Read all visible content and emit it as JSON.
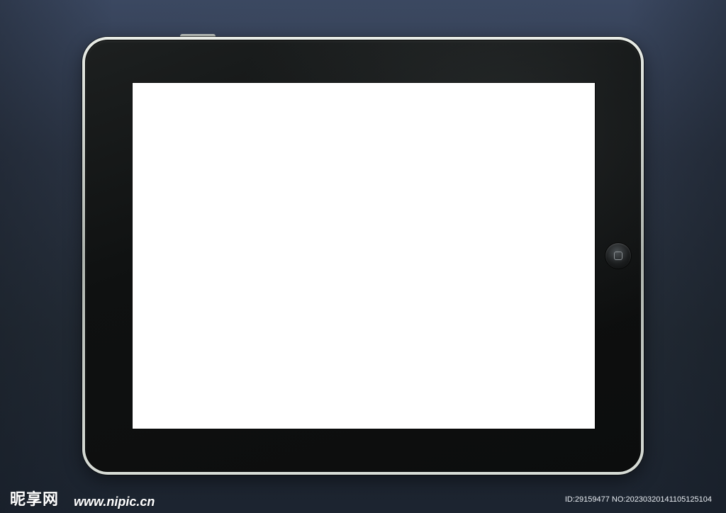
{
  "tablet": {
    "screen_color": "#ffffff",
    "bezel_color": "#0f1111",
    "frame_color": "#cfd4cf",
    "home_button_icon": "home-button-icon"
  },
  "watermark": {
    "logo_text": "昵享网",
    "url_text": "www.nipic.cn",
    "id_text": "ID:29159477 NO:20230320141105125104"
  }
}
